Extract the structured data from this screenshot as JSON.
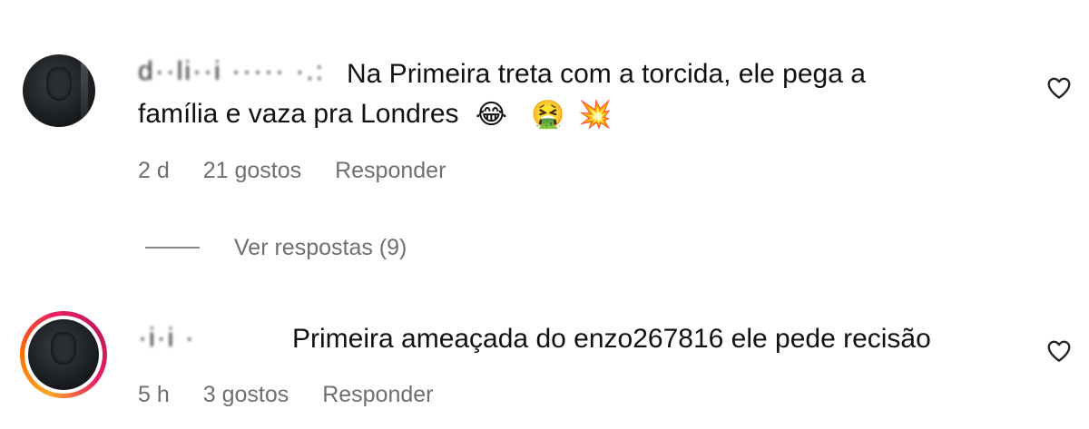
{
  "comments": [
    {
      "username": "d··li··i ····· ·.:",
      "text_line1": "Na Primeira treta com a torcida, ele pega a",
      "text_line2": "família e vaza pra Londres",
      "emojis": [
        "😂",
        "🤮",
        "💥"
      ],
      "time": "2 d",
      "likes": "21 gostos",
      "reply_label": "Responder",
      "view_replies": "Ver respostas (9)",
      "avatar_story_ring": false
    },
    {
      "username": "·i·i ·",
      "text_line1": "Primeira ameaçada do enzo267816 ele pede recisão",
      "time": "5 h",
      "likes": "3 gostos",
      "reply_label": "Responder",
      "avatar_story_ring": true
    }
  ],
  "icons": {
    "like": "heart-outline-icon"
  },
  "colors": {
    "meta_text": "#6f6f6f",
    "story_ring_start": "#f9a825",
    "story_ring_end": "#c2185b"
  }
}
